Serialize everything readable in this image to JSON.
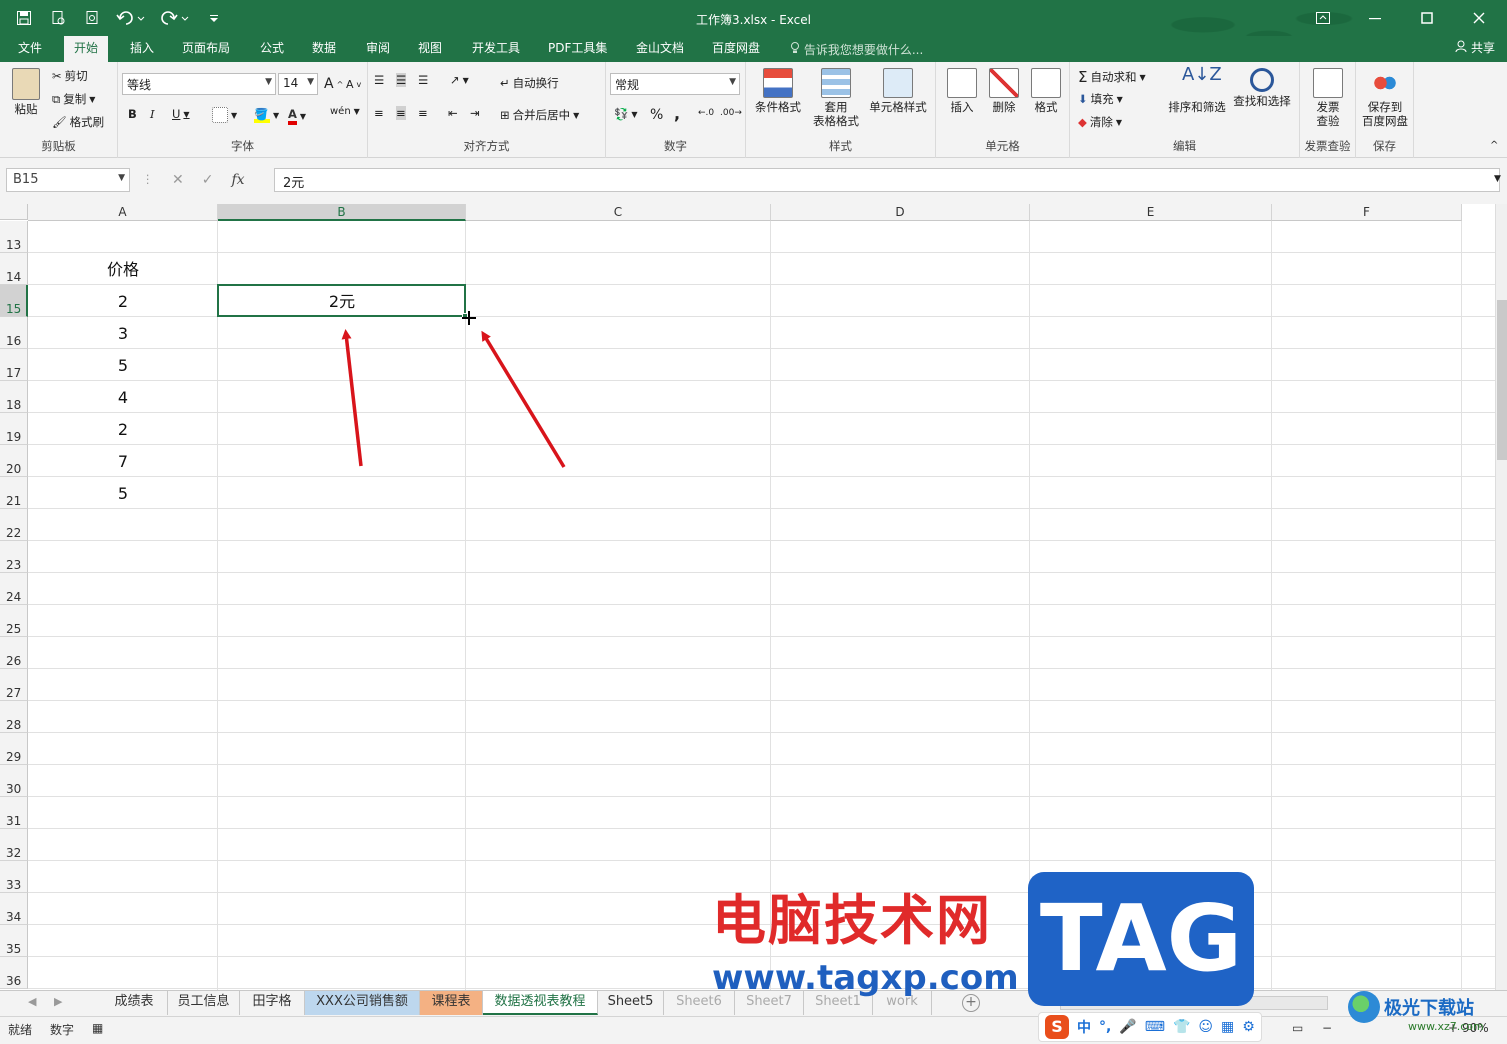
{
  "window": {
    "title": "工作簿3.xlsx - Excel"
  },
  "menu_tabs": [
    "文件",
    "开始",
    "插入",
    "页面布局",
    "公式",
    "数据",
    "审阅",
    "视图",
    "开发工具",
    "PDF工具集",
    "金山文档",
    "百度网盘"
  ],
  "active_tab": "开始",
  "tell_me": "告诉我您想要做什么...",
  "share": "共享",
  "ribbon": {
    "clipboard": {
      "paste": "粘贴",
      "cut": "剪切",
      "copy": "复制",
      "format_painter": "格式刷",
      "label": "剪贴板"
    },
    "font": {
      "name": "等线",
      "size": "14",
      "label": "字体",
      "bold": "B",
      "italic": "I",
      "underline": "U",
      "grow": "A",
      "shrink": "A",
      "wen": "wén"
    },
    "alignment": {
      "wrap": "自动换行",
      "merge": "合并后居中",
      "label": "对齐方式"
    },
    "number": {
      "format": "常规",
      "label": "数字",
      "percent": "%",
      "comma": ","
    },
    "styles": {
      "conditional": "条件格式",
      "table_format_1": "套用",
      "table_format_2": "表格格式",
      "cell_styles": "单元格样式",
      "label": "样式"
    },
    "cells": {
      "insert": "插入",
      "delete": "删除",
      "format": "格式",
      "label": "单元格"
    },
    "editing": {
      "autosum": "自动求和",
      "fill": "填充",
      "clear": "清除",
      "sort_filter": "排序和筛选",
      "find_select": "查找和选择",
      "label": "编辑"
    },
    "invoice": {
      "check_1": "发票",
      "check_2": "查验",
      "label": "发票查验"
    },
    "save": {
      "baidu_1": "保存到",
      "baidu_2": "百度网盘",
      "label": "保存"
    }
  },
  "formula_bar": {
    "name_box": "B15",
    "fx": "fx",
    "value": "2元"
  },
  "columns": [
    "A",
    "B",
    "C",
    "D",
    "E",
    "F"
  ],
  "selected_column": "B",
  "rows": [
    "13",
    "14",
    "15",
    "16",
    "17",
    "18",
    "19",
    "20",
    "21",
    "22",
    "23",
    "24",
    "25",
    "26",
    "27",
    "28",
    "29",
    "30",
    "31",
    "32",
    "33",
    "34",
    "35",
    "36"
  ],
  "selected_row": "15",
  "cells": {
    "A14": "价格",
    "A15": "2",
    "A16": "3",
    "A17": "5",
    "A18": "4",
    "A19": "2",
    "A20": "7",
    "A21": "5",
    "B15": "2元"
  },
  "sheet_tabs": [
    {
      "name": "成绩表",
      "style": "normal"
    },
    {
      "name": "员工信息",
      "style": "normal"
    },
    {
      "name": "田字格",
      "style": "normal"
    },
    {
      "name": "XXX公司销售额",
      "style": "blue"
    },
    {
      "name": "课程表",
      "style": "orange"
    },
    {
      "name": "数据透视表教程",
      "style": "active"
    },
    {
      "name": "Sheet5",
      "style": "normal"
    },
    {
      "name": "Sheet6",
      "style": "faded"
    },
    {
      "name": "Sheet7",
      "style": "faded"
    },
    {
      "name": "Sheet1",
      "style": "faded"
    },
    {
      "name": "work",
      "style": "faded"
    }
  ],
  "status": {
    "ready": "就绪",
    "mode": "数字",
    "zoom": "90%"
  },
  "ime": {
    "logo": "S",
    "lang": "中"
  },
  "watermark": {
    "cn": "电脑技术网",
    "url": "www.tagxp.com",
    "tag": "TAG",
    "site": "极光下载站",
    "site_url": "www.xz7.com"
  },
  "colors": {
    "excel_green": "#217346",
    "arrow_red": "#d8141b"
  }
}
